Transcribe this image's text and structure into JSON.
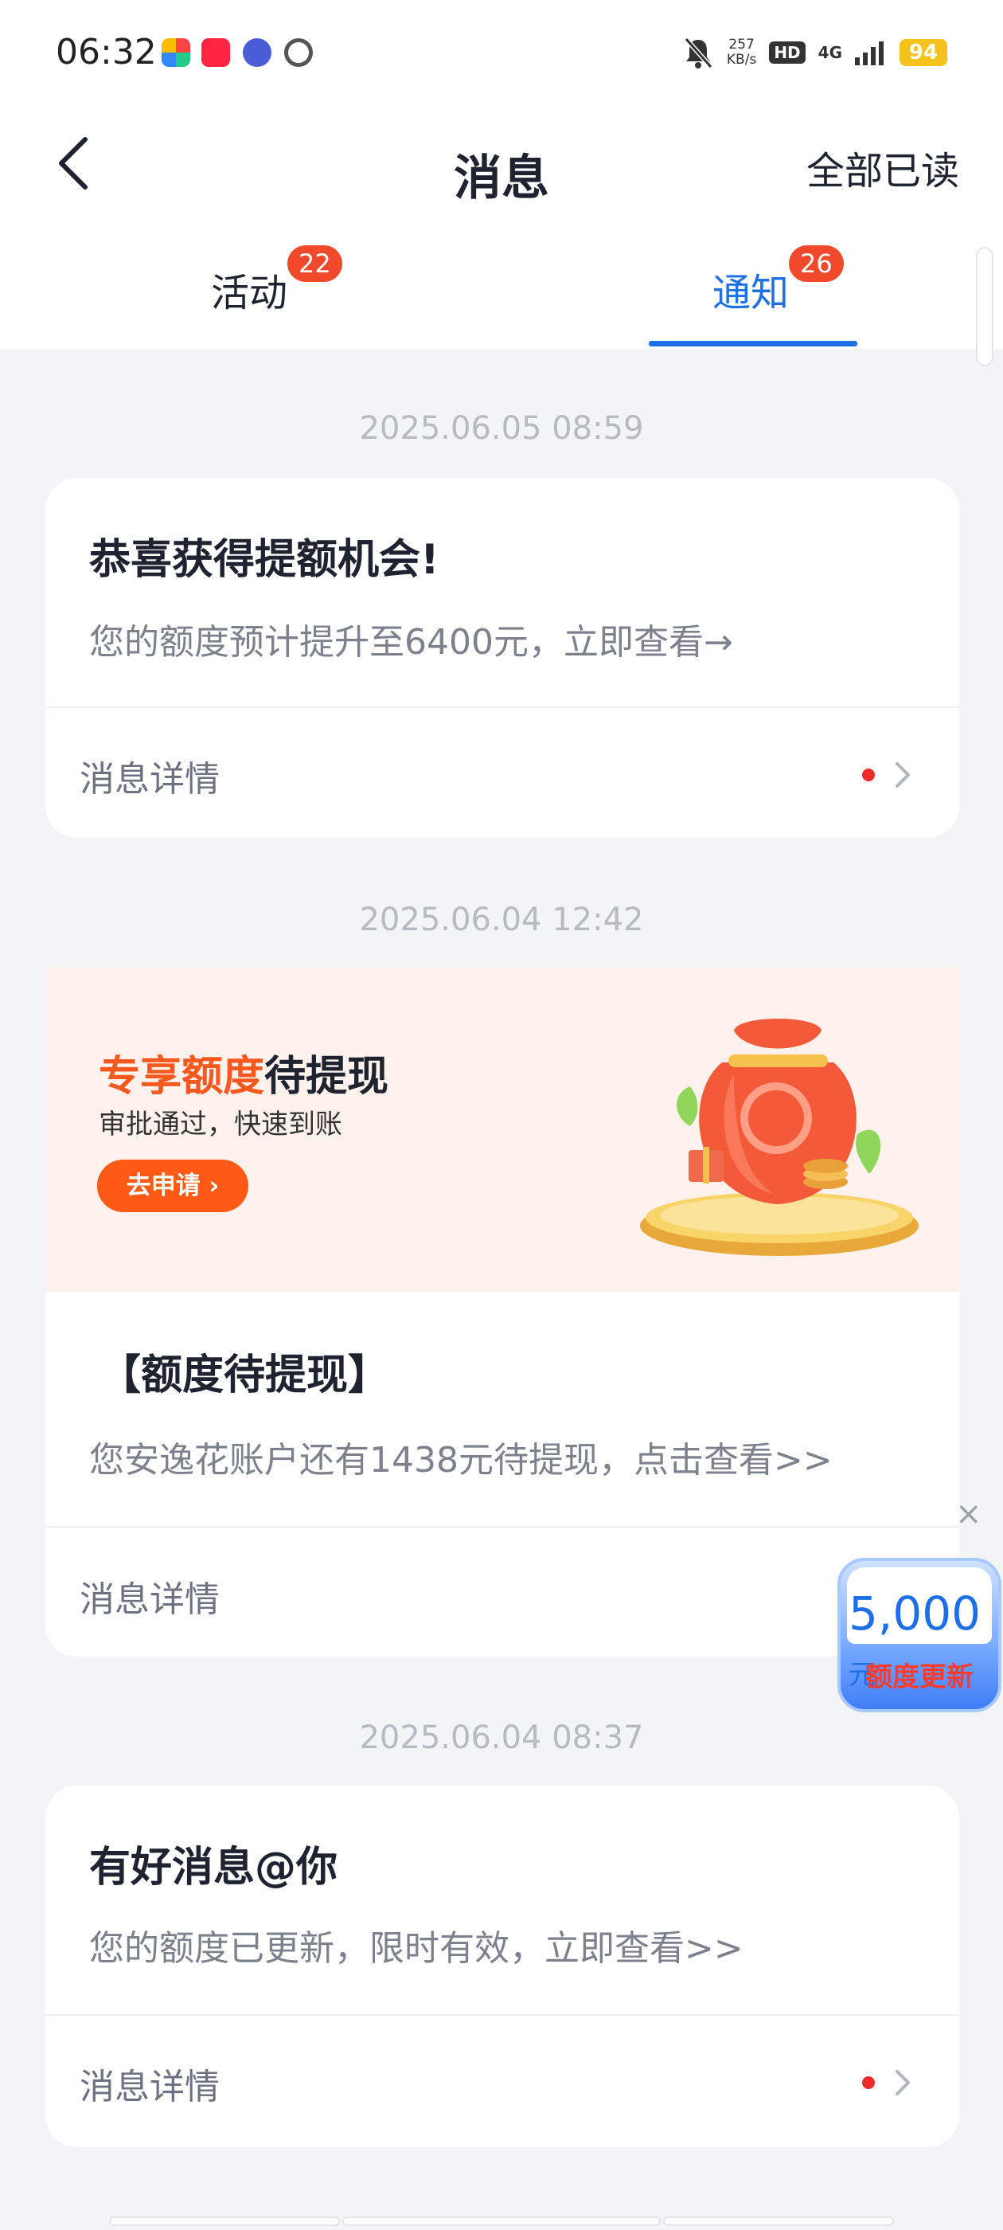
{
  "status_bar": {
    "time": "06:32",
    "speed_value": "257",
    "speed_unit": "KB/s",
    "hd": "HD",
    "network": "4G",
    "battery": "94",
    "icons": [
      "dnd-bell-off-icon",
      "signal-bars-icon",
      "battery-icon"
    ],
    "app_icons": [
      "pinwheel-app-icon",
      "xiaohongshu-app-icon",
      "tieba-app-icon",
      "link-app-icon"
    ]
  },
  "header": {
    "title": "消息",
    "mark_all_read": "全部已读"
  },
  "tabs": [
    {
      "label": "活动",
      "badge": "22",
      "active": false
    },
    {
      "label": "通知",
      "badge": "26",
      "active": true
    }
  ],
  "messages": [
    {
      "timestamp": "2025.06.05  08:59",
      "title": "恭喜获得提额机会!",
      "description": "您的额度预计提升至6400元，立即查看→",
      "detail_label": "消息详情",
      "unread": true
    },
    {
      "timestamp": "2025.06.04  12:42",
      "banner": {
        "headline_highlight": "专享额度",
        "headline_rest": "待提现",
        "subtitle": "审批通过，快速到账",
        "button_label": "去申请 ›"
      },
      "title": "【额度待提现】",
      "description": "您安逸花账户还有1438元待提现，点击查看>>",
      "detail_label": "消息详情",
      "unread": false
    },
    {
      "timestamp": "2025.06.04  08:37",
      "title": "有好消息@你",
      "description": "您的额度已更新，限时有效，立即查看>>",
      "detail_label": "消息详情",
      "unread": true
    }
  ],
  "floating_widget": {
    "close": "×",
    "amount": "5,000",
    "unit": "元",
    "label": "额度更新"
  },
  "colors": {
    "accent": "#1e6fe6",
    "badge": "#f0492c",
    "banner_bg": "#fff1ec",
    "banner_button": "#ff5a16",
    "unread_dot": "#ee2a2a",
    "page_bg": "#f3f4f6"
  }
}
